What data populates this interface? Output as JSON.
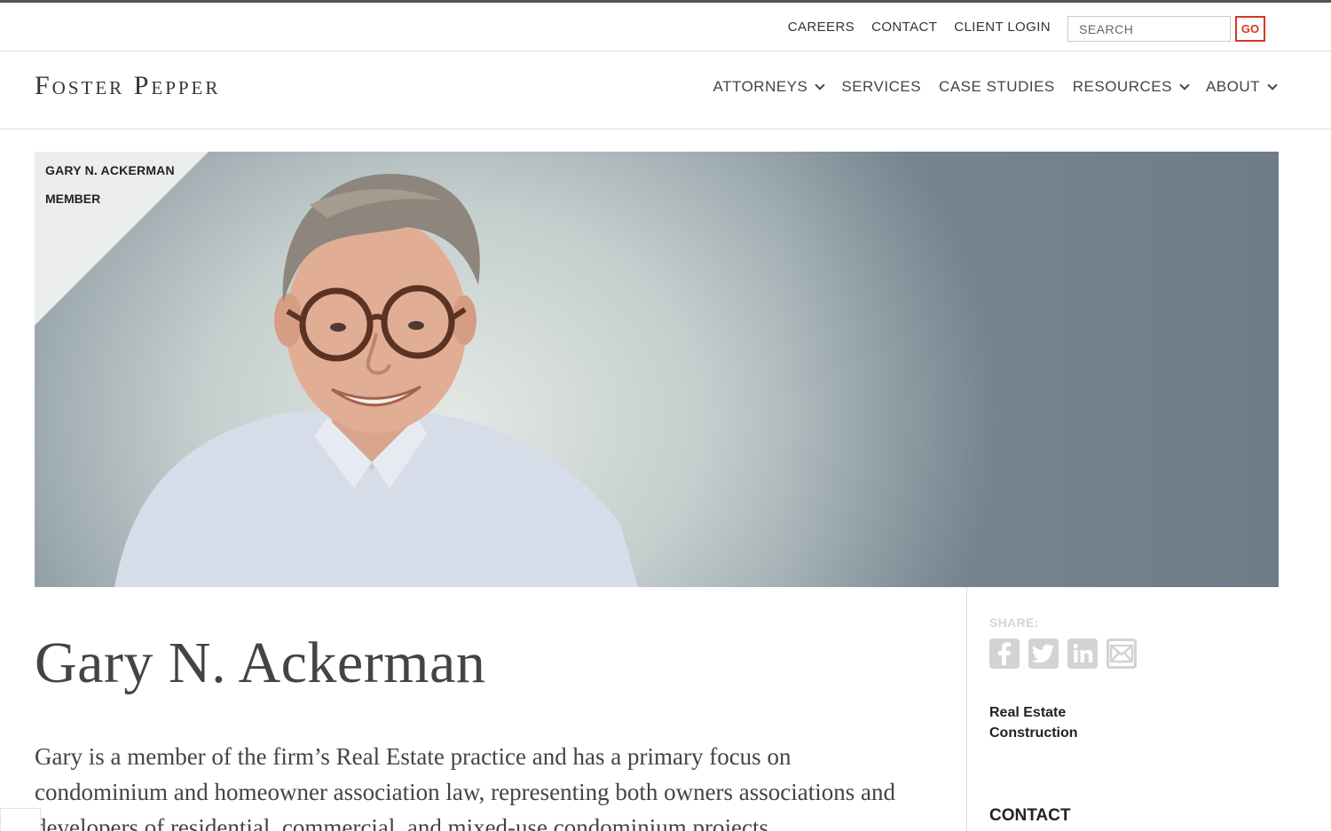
{
  "utility": {
    "links": [
      "CAREERS",
      "CONTACT",
      "CLIENT LOGIN"
    ],
    "search_placeholder": "SEARCH",
    "go_label": "GO"
  },
  "brand": {
    "logo_text": "Foster Pepper"
  },
  "nav": {
    "items": [
      {
        "label": "ATTORNEYS",
        "has_dropdown": true
      },
      {
        "label": "SERVICES",
        "has_dropdown": false
      },
      {
        "label": "CASE STUDIES",
        "has_dropdown": false
      },
      {
        "label": "RESOURCES",
        "has_dropdown": true
      },
      {
        "label": "ABOUT",
        "has_dropdown": true
      }
    ]
  },
  "hero": {
    "name": "GARY N. ACKERMAN",
    "role": "MEMBER"
  },
  "profile": {
    "title": "Gary N. Ackerman",
    "bio": "Gary is a member of the firm’s Real Estate practice and has a primary focus on condominium and homeowner association law, representing both owners associations and developers of residential, commercial, and mixed-use condominium projects."
  },
  "sidebar": {
    "share_label": "SHARE:",
    "share_icons": [
      "facebook-icon",
      "twitter-icon",
      "linkedin-icon",
      "email-icon"
    ],
    "practice_areas": [
      "Real Estate",
      "Construction"
    ],
    "contact_heading": "CONTACT"
  },
  "colors": {
    "accent": "#d4381e",
    "text": "#333333",
    "share_icon": "#d3d3d3"
  }
}
